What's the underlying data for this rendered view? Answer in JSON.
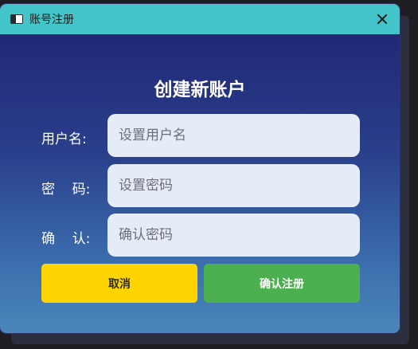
{
  "window": {
    "title": "账号注册",
    "icon": "window-icon",
    "close_icon": "close-icon"
  },
  "form": {
    "heading": "创建新账户",
    "username": {
      "label": "用户名:",
      "placeholder": "设置用户名",
      "value": ""
    },
    "password": {
      "label": "密    码:",
      "placeholder": "设置密码",
      "value": ""
    },
    "confirm": {
      "label": "确    认:",
      "placeholder": "确认密码",
      "value": ""
    }
  },
  "buttons": {
    "cancel_label": "取消",
    "confirm_label": "确认注册"
  },
  "colors": {
    "titlebar": "#42c4c9",
    "cancel_button": "#ffd400",
    "confirm_button": "#4caf50",
    "input_background": "#e6ecf6"
  }
}
